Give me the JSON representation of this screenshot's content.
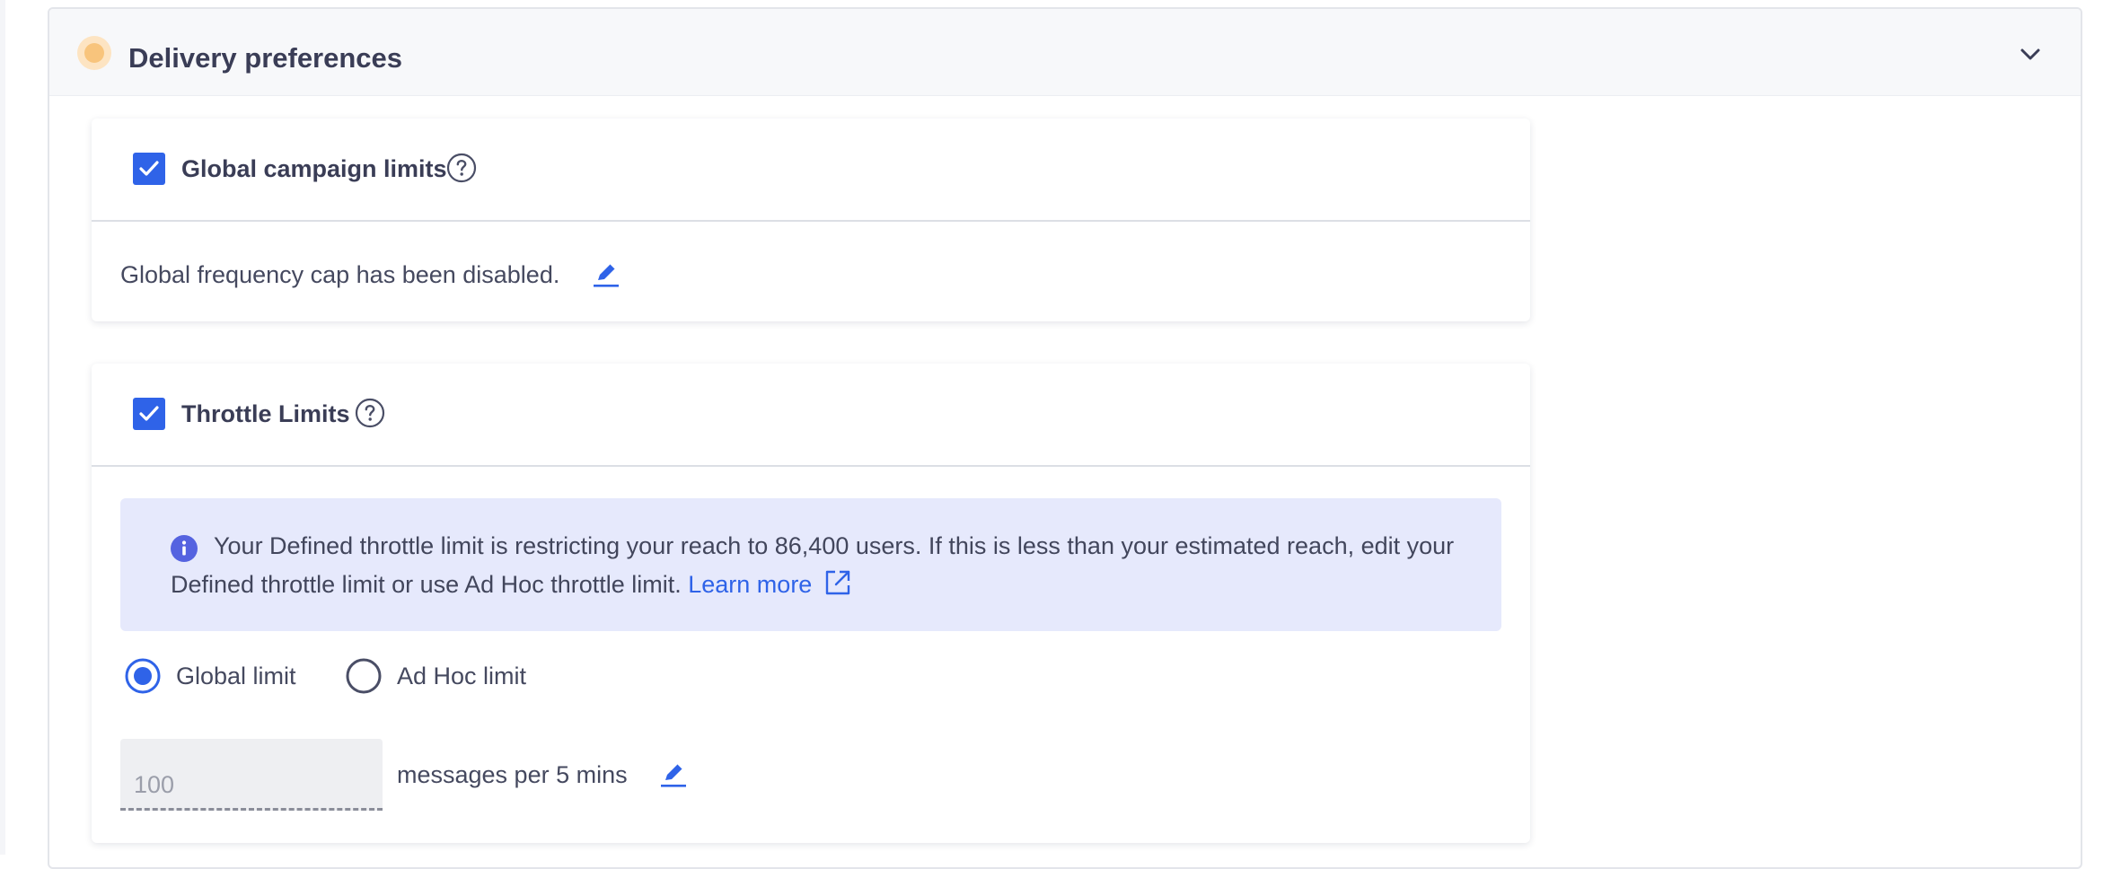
{
  "section": {
    "title": "Delivery preferences",
    "status_color": "#f8c47c"
  },
  "campaign_limits": {
    "checked": true,
    "title": "Global campaign limits",
    "message": "Global frequency cap has been disabled."
  },
  "throttle_limits": {
    "checked": true,
    "title": "Throttle Limits",
    "info_message": "Your Defined throttle limit is restricting your reach to 86,400 users. If this is less than your estimated reach, edit your Defined throttle limit or use Ad Hoc throttle limit.",
    "learn_more": "Learn more",
    "options": [
      {
        "label": "Global limit",
        "selected": true
      },
      {
        "label": "Ad Hoc limit",
        "selected": false
      }
    ],
    "limit_placeholder": "100",
    "limit_unit": "messages per 5 mins"
  },
  "colors": {
    "accent": "#2f63e8",
    "info_background": "#e6e9fc",
    "header_background": "#f7f8fa"
  }
}
